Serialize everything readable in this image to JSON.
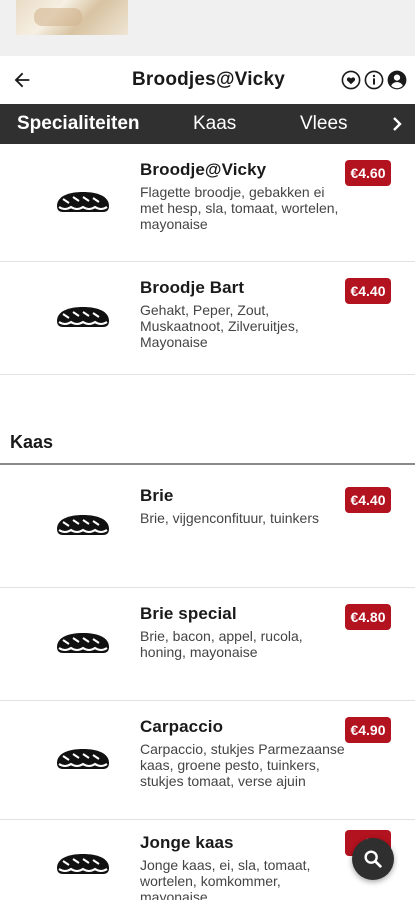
{
  "header": {
    "title": "Broodjes@Vicky",
    "icons": [
      "back-arrow-icon",
      "heart-icon",
      "info-icon",
      "account-icon"
    ]
  },
  "tabs": [
    {
      "label": "Specialiteiten",
      "active": true
    },
    {
      "label": "Kaas",
      "active": false
    },
    {
      "label": "Vlees",
      "active": false
    }
  ],
  "colors": {
    "price_badge": "#b3121f",
    "tab_bar": "#303030"
  },
  "sections": {
    "specialiteiten": {
      "items": [
        {
          "name": "Broodje@Vicky",
          "desc": "Flagette broodje, gebakken ei met hesp, sla, tomaat, wortelen, mayonaise",
          "price": "€4.60"
        },
        {
          "name": "Broodje Bart",
          "desc": "Gehakt, Peper, Zout, Muskaatnoot, Zilveruitjes, Mayonaise",
          "price": "€4.40"
        }
      ]
    },
    "kaas": {
      "title": "Kaas",
      "items": [
        {
          "name": "Brie",
          "desc": "Brie, vijgenconfituur, tuinkers",
          "price": "€4.40"
        },
        {
          "name": "Brie special",
          "desc": "Brie, bacon, appel, rucola, honing, mayonaise",
          "price": "€4.80"
        },
        {
          "name": "Carpaccio",
          "desc": "Carpaccio, stukjes Parmezaanse kaas, groene pesto, tuinkers, stukjes tomaat, verse ajuin",
          "price": "€4.90"
        },
        {
          "name": "Jonge kaas",
          "desc": "Jonge kaas, ei, sla, tomaat, wortelen, komkommer, mayonaise",
          "price": "€"
        }
      ]
    }
  },
  "fab": {
    "icon": "search-icon"
  }
}
